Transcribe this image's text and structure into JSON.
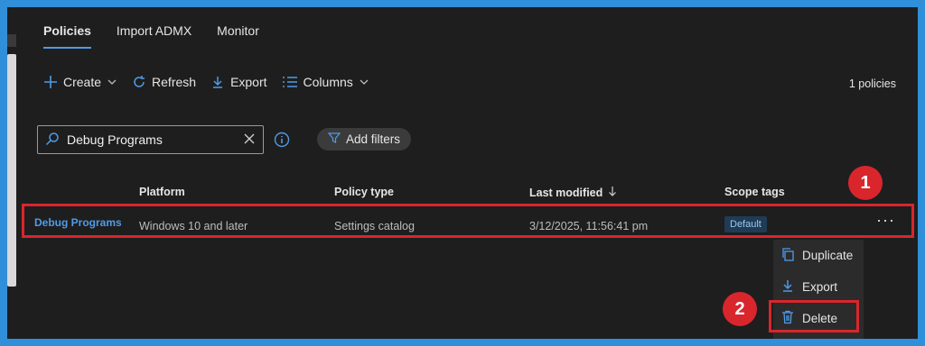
{
  "tabs": [
    {
      "label": "Policies",
      "active": true
    },
    {
      "label": "Import ADMX",
      "active": false
    },
    {
      "label": "Monitor",
      "active": false
    }
  ],
  "toolbar": {
    "create": "Create",
    "refresh": "Refresh",
    "export": "Export",
    "columns": "Columns",
    "policy_count": "1 policies"
  },
  "search": {
    "value": "Debug Programs"
  },
  "filters": {
    "add_filters": "Add filters"
  },
  "table": {
    "headers": [
      "Platform",
      "Policy type",
      "Last modified",
      "Scope tags"
    ],
    "rows": [
      {
        "name": "Debug Programs",
        "platform": "Windows 10 and later",
        "policy_type": "Settings catalog",
        "last_modified": "3/12/2025, 11:56:41 pm",
        "scope_tag": "Default"
      }
    ]
  },
  "context_menu": {
    "items": [
      "Duplicate",
      "Export",
      "Delete"
    ]
  },
  "markers": [
    "1",
    "2"
  ],
  "colors": {
    "accent": "#4f9be8",
    "highlight": "#d9262c",
    "background": "#1e1e1e",
    "outer_border": "#2f8fd8"
  }
}
